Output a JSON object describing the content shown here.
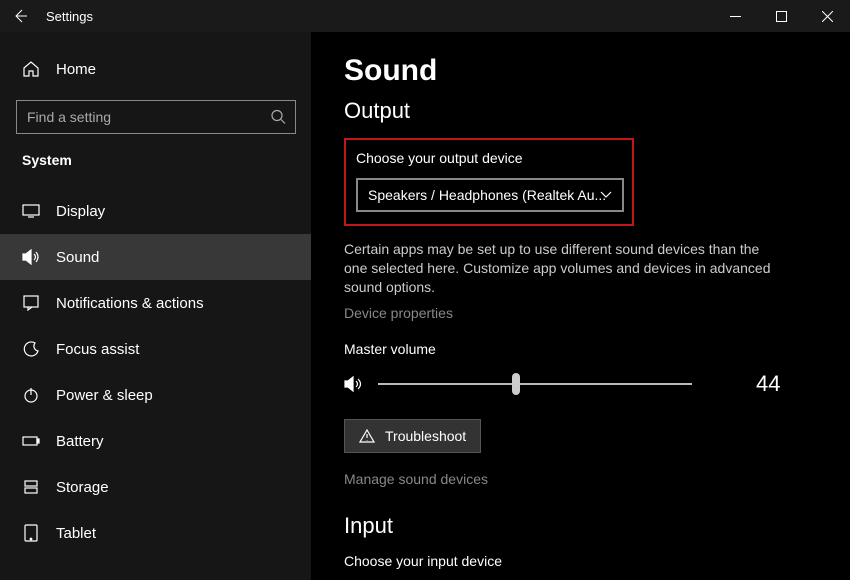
{
  "titlebar": {
    "title": "Settings"
  },
  "sidebar": {
    "home": "Home",
    "search_placeholder": "Find a setting",
    "group": "System",
    "items": [
      {
        "label": "Display"
      },
      {
        "label": "Sound"
      },
      {
        "label": "Notifications & actions"
      },
      {
        "label": "Focus assist"
      },
      {
        "label": "Power & sleep"
      },
      {
        "label": "Battery"
      },
      {
        "label": "Storage"
      },
      {
        "label": "Tablet"
      }
    ]
  },
  "main": {
    "title": "Sound",
    "output_hdr": "Output",
    "choose_output": "Choose your output device",
    "output_value": "Speakers / Headphones (Realtek Au...",
    "help": "Certain apps may be set up to use different sound devices than the one selected here. Customize app volumes and devices in advanced sound options.",
    "device_props": "Device properties",
    "master_volume": "Master volume",
    "volume_value": "44",
    "troubleshoot": "Troubleshoot",
    "manage": "Manage sound devices",
    "input_hdr": "Input",
    "choose_input": "Choose your input device"
  }
}
